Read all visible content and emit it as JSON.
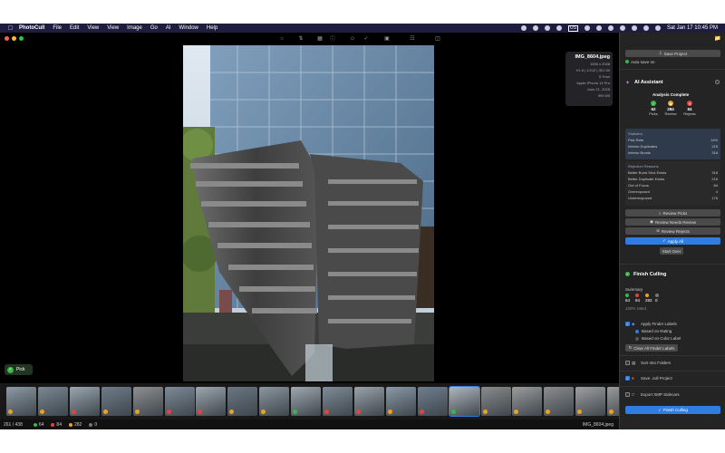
{
  "menubar": {
    "app_name": "PhotoCull",
    "items": [
      "File",
      "Edit",
      "View",
      "View",
      "Image",
      "Go",
      "AI",
      "Window",
      "Help"
    ],
    "input_source": "US",
    "datetime": "Sat Jan 17  10:45 PM"
  },
  "info": {
    "filename": "IMG_8604.jpeg",
    "lines": [
      "1536 x 2048",
      "f/1.8 | 1/212 | ISO 50",
      "5.7mm",
      "Apple iPhone 14 Pro",
      "June 21, 2025",
      "999 KB"
    ]
  },
  "viewer": {
    "pick_label": "Pick"
  },
  "status": {
    "counter": "261 / 438",
    "picks": "64",
    "rejects": "84",
    "review": "282",
    "unrated": "0",
    "filename": "IMG_8604.jpeg"
  },
  "sidebar": {
    "save_project": "Save Project",
    "auto_save": "Auto-save on",
    "ai_title": "AI Assistant",
    "analysis_complete": "Analysis Complete",
    "picks_num": "62",
    "picks_label": "Picks",
    "review_num": "284",
    "review_label": "Review",
    "rejects_num": "84",
    "rejects_label": "Rejects",
    "statistics_title": "Statistics",
    "stats": [
      {
        "label": "Pick Rate",
        "value": "14%"
      },
      {
        "label": "Inferior Duplicates",
        "value": "215"
      },
      {
        "label": "Inferior Bursts",
        "value": "318"
      }
    ],
    "rejection_title": "Rejection Reasons",
    "reasons": [
      {
        "label": "Better Burst Shot Exists",
        "value": "318"
      },
      {
        "label": "Better Duplicate Exists",
        "value": "215"
      },
      {
        "label": "Out of Focus",
        "value": "84"
      },
      {
        "label": "Overexposed",
        "value": "4"
      },
      {
        "label": "Underexposed",
        "value": "176"
      }
    ],
    "review_picks": "Review Picks",
    "review_needs": "Review Needs Review",
    "review_rejects": "Review Rejects",
    "apply_all": "Apply All",
    "start_over": "Start Over",
    "finish_title": "Finish Culling",
    "summary_label": "Summary",
    "summary": [
      "64",
      "84",
      "282",
      "0"
    ],
    "rated": "100% rated",
    "apply_finder": "Apply Finder Labels",
    "based_rating": "Based on Rating",
    "based_color": "Based on Color Label",
    "clear_finder": "Clear All Finder Labels",
    "sort_folders": "Sort Into Folders",
    "save_project_file": "Save .cull Project",
    "export_xmp": "Export XMP Sidecars",
    "finish_button": "Finish Culling"
  },
  "colors": {
    "accent": "#2f7de1",
    "pick": "#3bb54a",
    "review": "#e9a326",
    "reject": "#e0463f"
  }
}
